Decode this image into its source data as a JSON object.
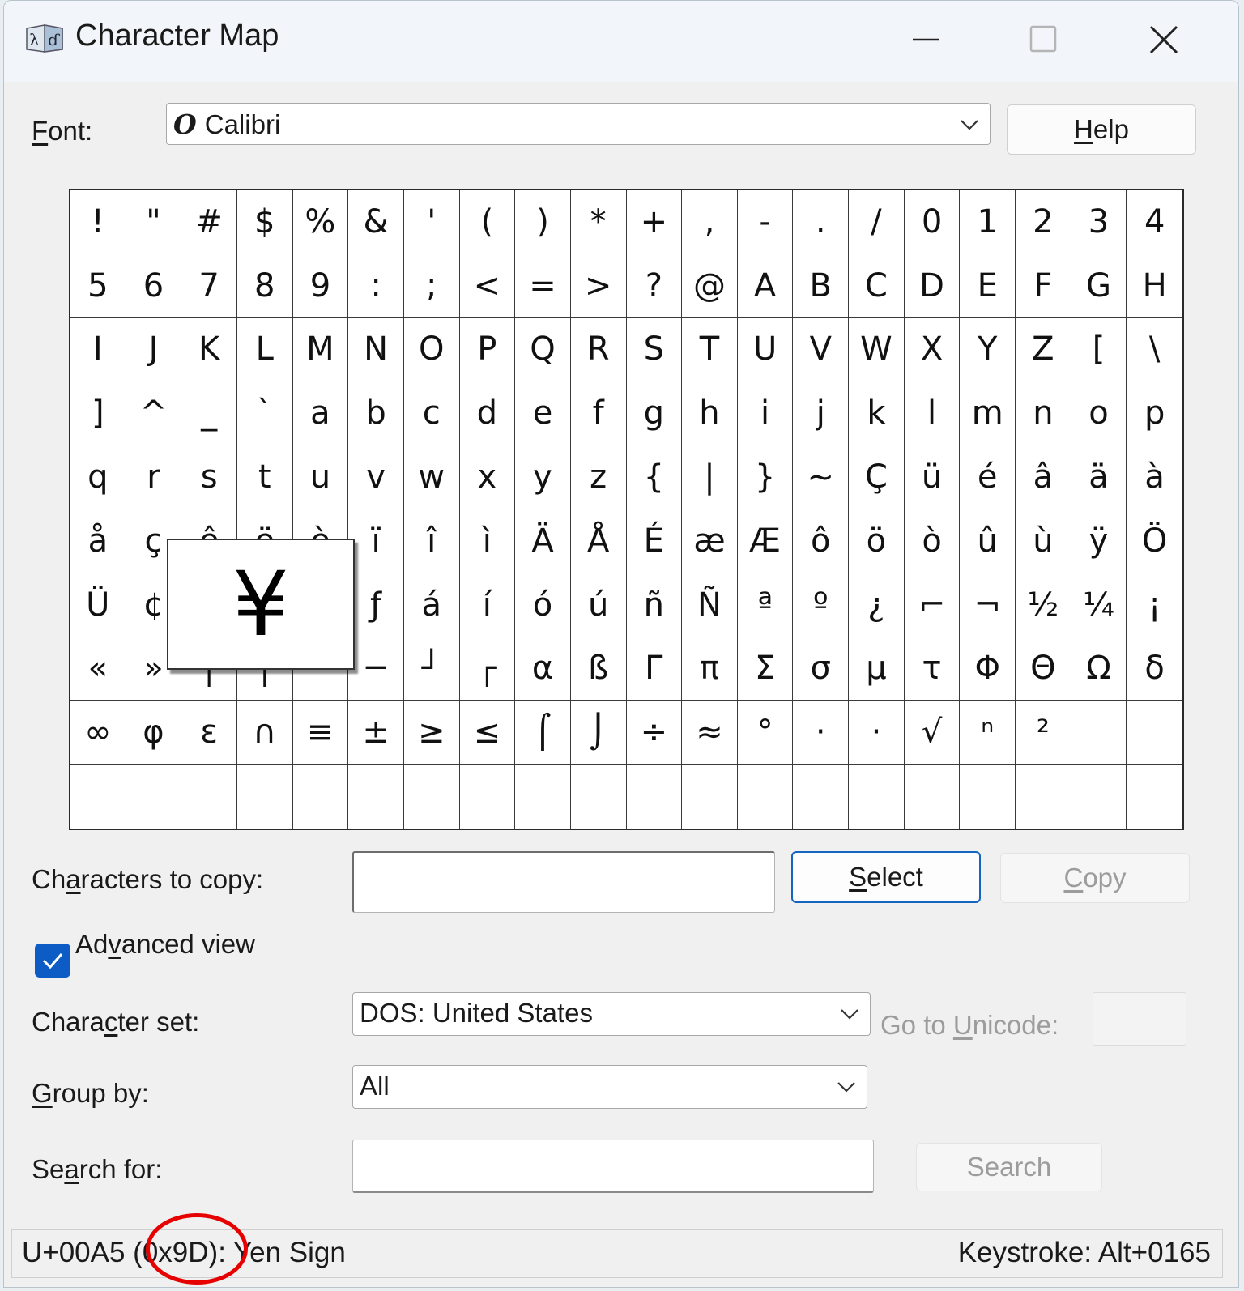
{
  "window": {
    "title": "Character Map",
    "icon": "character-map-app-icon"
  },
  "font": {
    "label_prefix": "",
    "label_underlined": "F",
    "label_rest": "ont:",
    "value": "Calibri",
    "font_type_icon": "opentype-font-icon"
  },
  "buttons": {
    "help_u": "H",
    "help_rest": "elp",
    "select_u": "S",
    "select_rest": "elect",
    "copy_u": "C",
    "copy_rest": "opy",
    "search": "Search"
  },
  "grid": {
    "cells": [
      "!",
      "\"",
      "#",
      "$",
      "%",
      "&",
      "'",
      "(",
      ")",
      "*",
      "+",
      ",",
      "-",
      ".",
      "/",
      "0",
      "1",
      "2",
      "3",
      "4",
      "5",
      "6",
      "7",
      "8",
      "9",
      ":",
      ";",
      "<",
      "=",
      ">",
      "?",
      "@",
      "A",
      "B",
      "C",
      "D",
      "E",
      "F",
      "G",
      "H",
      "I",
      "J",
      "K",
      "L",
      "M",
      "N",
      "O",
      "P",
      "Q",
      "R",
      "S",
      "T",
      "U",
      "V",
      "W",
      "X",
      "Y",
      "Z",
      "[",
      "\\",
      "]",
      "^",
      "_",
      "`",
      "a",
      "b",
      "c",
      "d",
      "e",
      "f",
      "g",
      "h",
      "i",
      "j",
      "k",
      "l",
      "m",
      "n",
      "o",
      "p",
      "q",
      "r",
      "s",
      "t",
      "u",
      "v",
      "w",
      "x",
      "y",
      "z",
      "{",
      "|",
      "}",
      "~",
      "Ç",
      "ü",
      "é",
      "â",
      "ä",
      "à",
      "å",
      "ç",
      "ê",
      "ë",
      "è",
      "ï",
      "î",
      "ì",
      "Ä",
      "Å",
      "É",
      "æ",
      "Æ",
      "ô",
      "ö",
      "ò",
      "û",
      "ù",
      "ÿ",
      "Ö",
      "Ü",
      "¢",
      "£",
      "¥",
      "₧",
      "ƒ",
      "á",
      "í",
      "ó",
      "ú",
      "ñ",
      "Ñ",
      "ª",
      "º",
      "¿",
      "⌐",
      "¬",
      "½",
      "¼",
      "¡",
      "«",
      "»",
      "┌",
      "┐",
      "",
      "─",
      "┘",
      "┌",
      "α",
      "ß",
      "Γ",
      "π",
      "Σ",
      "σ",
      "µ",
      "τ",
      "Φ",
      "Θ",
      "Ω",
      "δ",
      "∞",
      "φ",
      "ε",
      "∩",
      "≡",
      "±",
      "≥",
      "≤",
      "⌠",
      "⌡",
      "÷",
      "≈",
      "°",
      "·",
      "·",
      "√",
      "ⁿ",
      "²",
      "",
      "",
      "",
      "",
      "",
      "",
      "",
      "",
      "",
      "",
      "",
      "",
      "",
      "",
      "",
      "",
      "",
      "",
      "",
      "",
      "",
      ""
    ],
    "zoomed_char": "¥"
  },
  "copy": {
    "label_a": "Ch",
    "label_u": "a",
    "label_b": "racters to copy:",
    "value": ""
  },
  "advanced": {
    "checked": true,
    "label_a": "Ad",
    "label_u": "v",
    "label_b": "anced view"
  },
  "charset": {
    "label_a": "Chara",
    "label_u": "c",
    "label_b": "ter set:",
    "value": "DOS: United States"
  },
  "goto": {
    "label_a": "Go to ",
    "label_u": "U",
    "label_b": "nicode:",
    "value": ""
  },
  "groupby": {
    "label_u": "G",
    "label_b": "roup by:",
    "value": "All"
  },
  "search": {
    "label_a": "Se",
    "label_u": "a",
    "label_b": "rch for:",
    "value": ""
  },
  "status": {
    "left": "U+00A5 (0x9D): Yen Sign",
    "right": "Keystroke: Alt+0165",
    "highlight_color": "#e60000"
  }
}
